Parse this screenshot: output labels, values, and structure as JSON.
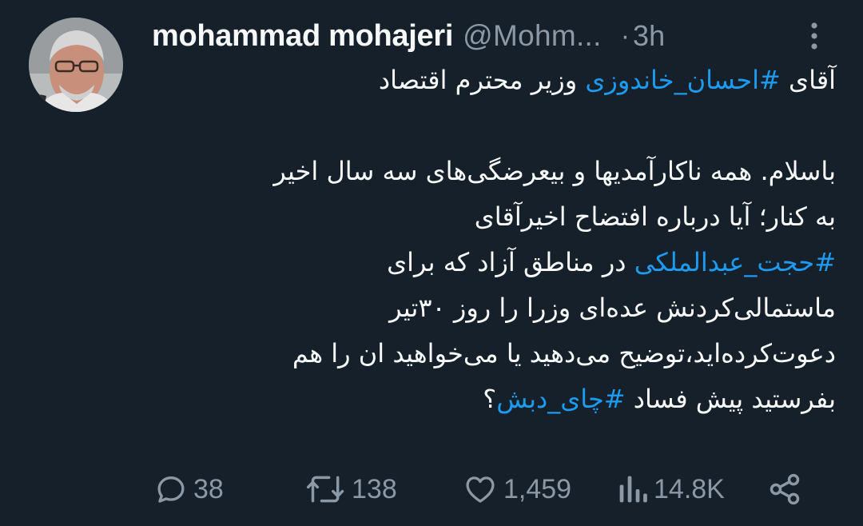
{
  "tweet": {
    "author_name": "mohammad mohajeri",
    "author_handle": "@Mohm...",
    "separator": "·",
    "time": "3h",
    "body_lines": [
      {
        "parts": [
          {
            "text": "آقای ",
            "tag": false
          },
          {
            "text": "#احسان_خاندوزی",
            "tag": true
          },
          {
            "text": " وزیر محترم اقتصاد",
            "tag": false
          }
        ]
      },
      {
        "blank": true
      },
      {
        "parts": [
          {
            "text": "باسلام. همه ناکارآمدیها و بیعرضگی‌های سه سال اخیر",
            "tag": false
          }
        ]
      },
      {
        "parts": [
          {
            "text": "به کنار؛ آیا درباره افتضاح اخیرآقای",
            "tag": false
          }
        ]
      },
      {
        "parts": [
          {
            "text": "#حجت_عبدالملکی",
            "tag": true
          },
          {
            "text": " در مناطق آزاد که برای",
            "tag": false
          }
        ]
      },
      {
        "parts": [
          {
            "text": "ماستمالی‌کردنش عده‌ای وزرا را روز ۳۰تیر",
            "tag": false
          }
        ]
      },
      {
        "parts": [
          {
            "text": "دعوت‌کرده‌اید،توضیح می‌دهید یا می‌خواهید ان را هم",
            "tag": false
          }
        ]
      },
      {
        "parts": [
          {
            "text": "بفرستید پیش فساد ",
            "tag": false
          },
          {
            "text": "#چای_دبش",
            "tag": true
          },
          {
            "text": "؟",
            "tag": false
          }
        ]
      }
    ],
    "hashtags": [
      "#احسان_خاندوزی",
      "#حجت_عبدالملکی",
      "#چای_دبش"
    ]
  },
  "actions": {
    "replies": "38",
    "retweets": "138",
    "likes": "1,459",
    "views": "14.8K"
  },
  "icons": {
    "more": "more-vertical-icon",
    "reply": "reply-icon",
    "retweet": "retweet-icon",
    "like": "heart-icon",
    "views": "views-icon",
    "share": "share-icon"
  },
  "colors": {
    "background": "#15202b",
    "text": "#f7f9f9",
    "secondary": "#8b98a5",
    "link": "#1d9bf0"
  }
}
